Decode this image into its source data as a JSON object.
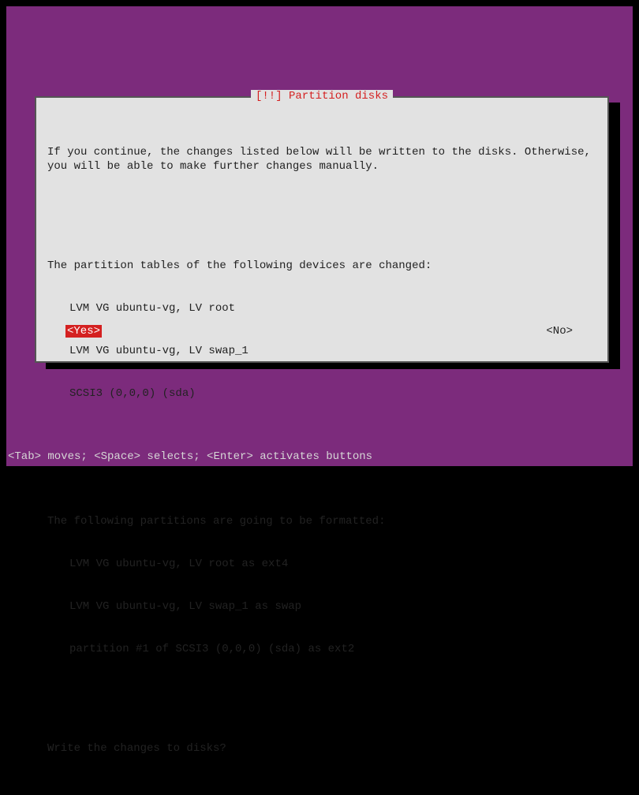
{
  "dialog": {
    "title": "[!!] Partition disks",
    "intro": "If you continue, the changes listed below will be written to the disks. Otherwise, you will be able to make further changes manually.",
    "changed_header": "The partition tables of the following devices are changed:",
    "changed_items": [
      "LVM VG ubuntu-vg, LV root",
      "LVM VG ubuntu-vg, LV swap_1",
      "SCSI3 (0,0,0) (sda)"
    ],
    "format_header": "The following partitions are going to be formatted:",
    "format_items": [
      "LVM VG ubuntu-vg, LV root as ext4",
      "LVM VG ubuntu-vg, LV swap_1 as swap",
      "partition #1 of SCSI3 (0,0,0) (sda) as ext2"
    ],
    "question": "Write the changes to disks?",
    "yes_label": "<Yes>",
    "no_label": "<No>"
  },
  "footer": {
    "help": "<Tab> moves; <Space> selects; <Enter> activates buttons"
  },
  "colors": {
    "bg_purple": "#7c2b7c",
    "dialog_bg": "#e2e2e2",
    "accent_red": "#d42020"
  }
}
